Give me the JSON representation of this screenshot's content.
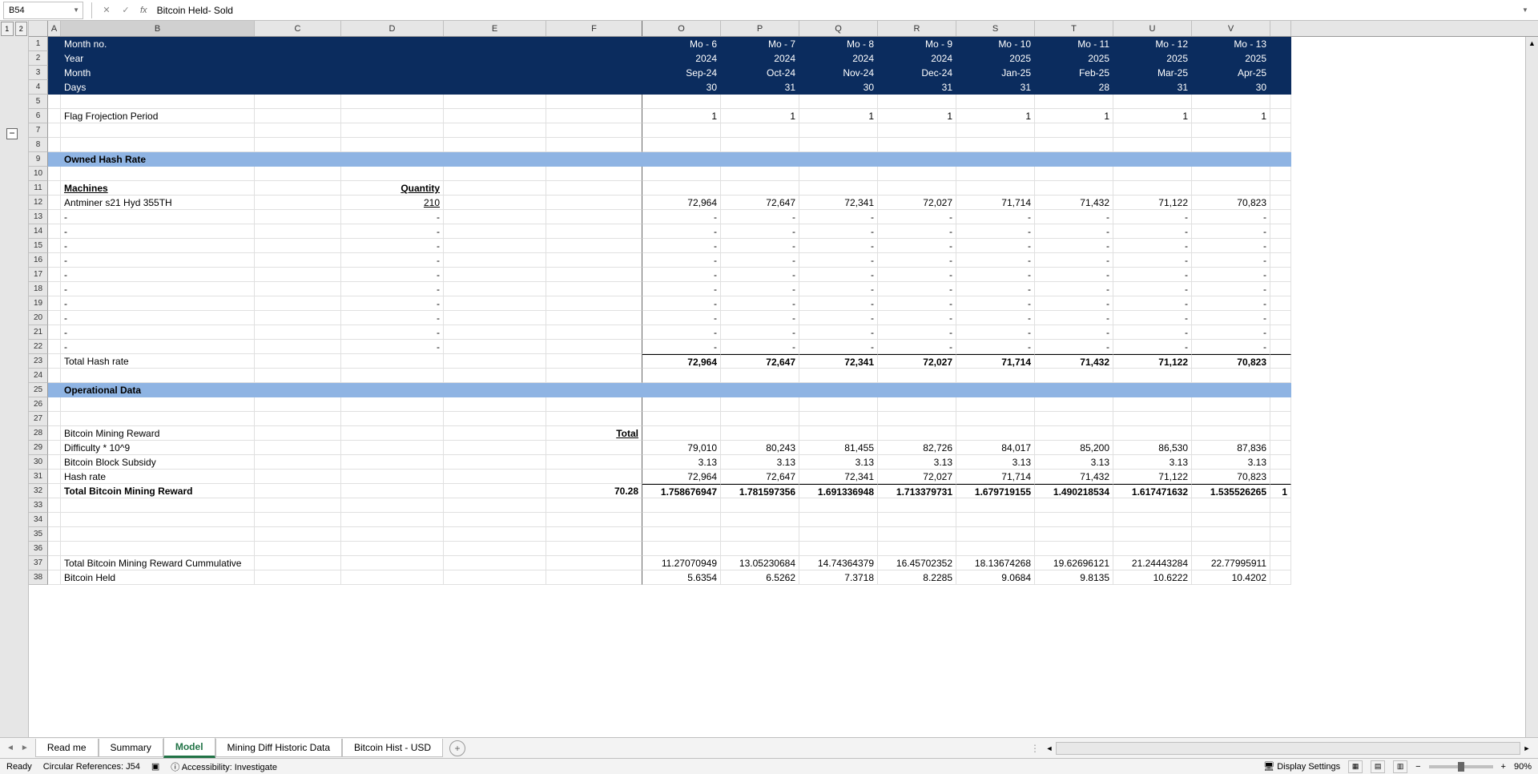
{
  "nameBox": "B54",
  "formulaValue": "Bitcoin Held- Sold",
  "columns": [
    "A",
    "B",
    "C",
    "D",
    "E",
    "F",
    "O",
    "P",
    "Q",
    "R",
    "S",
    "T",
    "U",
    "V"
  ],
  "rowLabels": [
    "1",
    "2",
    "3",
    "4",
    "5",
    "6",
    "7",
    "8",
    "9",
    "10",
    "11",
    "12",
    "13",
    "14",
    "15",
    "16",
    "17",
    "18",
    "19",
    "20",
    "21",
    "22",
    "23",
    "24",
    "25",
    "26",
    "27",
    "28",
    "29",
    "30",
    "31",
    "32",
    "33",
    "34",
    "35",
    "36",
    "37",
    "38"
  ],
  "headerRows": {
    "monthNo": {
      "label": "Month no.",
      "vals": [
        "Mo - 6",
        "Mo - 7",
        "Mo - 8",
        "Mo - 9",
        "Mo - 10",
        "Mo - 11",
        "Mo - 12",
        "Mo - 13"
      ]
    },
    "year": {
      "label": "Year",
      "vals": [
        "2024",
        "2024",
        "2024",
        "2024",
        "2025",
        "2025",
        "2025",
        "2025"
      ]
    },
    "month": {
      "label": "Month",
      "vals": [
        "Sep-24",
        "Oct-24",
        "Nov-24",
        "Dec-24",
        "Jan-25",
        "Feb-25",
        "Mar-25",
        "Apr-25"
      ]
    },
    "days": {
      "label": "Days",
      "vals": [
        "30",
        "31",
        "30",
        "31",
        "31",
        "28",
        "31",
        "30"
      ]
    }
  },
  "flagRow": {
    "label": "Flag Frojection Period",
    "vals": [
      "1",
      "1",
      "1",
      "1",
      "1",
      "1",
      "1",
      "1"
    ]
  },
  "sections": {
    "ownedHash": "Owned Hash Rate",
    "opData": "Operational Data"
  },
  "machines": {
    "header": {
      "b": "Machines",
      "d": "Quantity"
    },
    "antminer": {
      "label": "Antminer s21 Hyd 355TH",
      "qty": "210",
      "vals": [
        "72,964",
        "72,647",
        "72,341",
        "72,027",
        "71,714",
        "71,432",
        "71,122",
        "70,823"
      ]
    },
    "dash": "-",
    "totalHash": {
      "label": "Total Hash rate",
      "vals": [
        "72,964",
        "72,647",
        "72,341",
        "72,027",
        "71,714",
        "71,432",
        "71,122",
        "70,823"
      ]
    }
  },
  "opRows": {
    "bmr": {
      "label": "Bitcoin Mining Reward",
      "f": "Total"
    },
    "difficulty": {
      "label": "Difficulty * 10^9",
      "vals": [
        "79,010",
        "80,243",
        "81,455",
        "82,726",
        "84,017",
        "85,200",
        "86,530",
        "87,836"
      ]
    },
    "subsidy": {
      "label": "Bitcoin Block Subsidy",
      "vals": [
        "3.13",
        "3.13",
        "3.13",
        "3.13",
        "3.13",
        "3.13",
        "3.13",
        "3.13"
      ]
    },
    "hashrate": {
      "label": "Hash rate",
      "vals": [
        "72,964",
        "72,647",
        "72,341",
        "72,027",
        "71,714",
        "71,432",
        "71,122",
        "70,823"
      ]
    },
    "totalBmr": {
      "label": "Total Bitcoin Mining Reward",
      "f": "70.28",
      "vals": [
        "1.758676947",
        "1.781597356",
        "1.691336948",
        "1.713379731",
        "1.679719155",
        "1.490218534",
        "1.617471632",
        "1.535526265"
      ],
      "extra": "1"
    },
    "cumm": {
      "label": "Total Bitcoin Mining Reward Cummulative",
      "vals": [
        "11.27070949",
        "13.05230684",
        "14.74364379",
        "16.45702352",
        "18.13674268",
        "19.62696121",
        "21.24443284",
        "22.77995911"
      ]
    },
    "held": {
      "label": "Bitcoin Held",
      "vals": [
        "5.6354",
        "6.5262",
        "7.3718",
        "8.2285",
        "9.0684",
        "9.8135",
        "10.6222",
        "10.4202"
      ]
    }
  },
  "tabs": [
    "Read me",
    "Summary",
    "Model",
    "Mining Diff Historic Data",
    "Bitcoin Hist - USD"
  ],
  "activeTab": "Model",
  "status": {
    "ready": "Ready",
    "circ": "Circular References: J54",
    "access": "Accessibility: Investigate",
    "display": "Display Settings",
    "zoom": "90%"
  }
}
